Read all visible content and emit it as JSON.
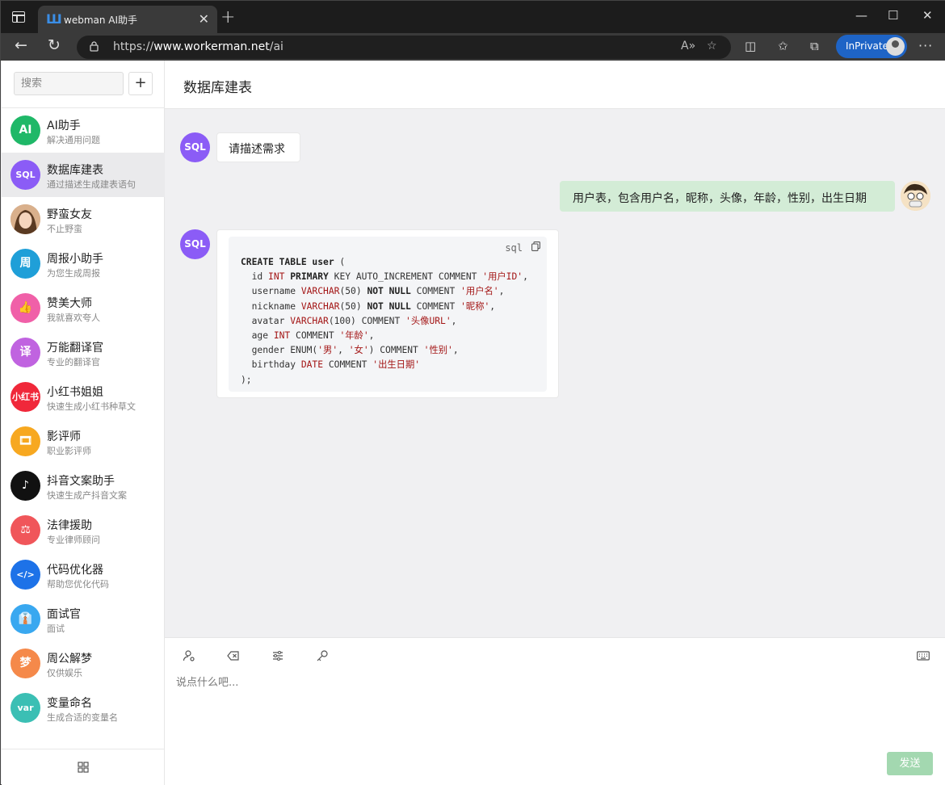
{
  "browser": {
    "tab_title": "webman AI助手",
    "url_scheme": "https://",
    "url_host": "www.workerman.net",
    "url_path": "/ai",
    "inprivate_label": "InPrivate"
  },
  "sidebar": {
    "search_placeholder": "搜索",
    "add_label": "+",
    "bots": [
      {
        "name": "AI助手",
        "desc": "解决通用问题",
        "avatar_text": "AI",
        "color": "#1fb868"
      },
      {
        "name": "数据库建表",
        "desc": "通过描述生成建表语句",
        "avatar_text": "SQL",
        "color": "#8b5cf6"
      },
      {
        "name": "野蛮女友",
        "desc": "不止野蛮",
        "avatar_text": "",
        "color": "#c9a07c"
      },
      {
        "name": "周报小助手",
        "desc": "为您生成周报",
        "avatar_text": "周",
        "color": "#1f9fd8"
      },
      {
        "name": "赞美大师",
        "desc": "我就喜欢夸人",
        "avatar_text": "👍",
        "color": "#f060a8"
      },
      {
        "name": "万能翻译官",
        "desc": "专业的翻译官",
        "avatar_text": "译",
        "color": "#c063e0"
      },
      {
        "name": "小红书姐姐",
        "desc": "快速生成小红书种草文",
        "avatar_text": "小红书",
        "color": "#f0283a"
      },
      {
        "name": "影评师",
        "desc": "职业影评师",
        "avatar_text": "🎞",
        "color": "#f7a820"
      },
      {
        "name": "抖音文案助手",
        "desc": "快速生成产抖音文案",
        "avatar_text": "♪",
        "color": "#111111"
      },
      {
        "name": "法律援助",
        "desc": "专业律师顾问",
        "avatar_text": "⚖",
        "color": "#f0565a"
      },
      {
        "name": "代码优化器",
        "desc": "帮助您优化代码",
        "avatar_text": "</>",
        "color": "#1d72e8"
      },
      {
        "name": "面试官",
        "desc": "面试",
        "avatar_text": "👔",
        "color": "#39a8f0"
      },
      {
        "name": "周公解梦",
        "desc": "仅供娱乐",
        "avatar_text": "梦",
        "color": "#f5894a"
      },
      {
        "name": "变量命名",
        "desc": "生成合适的变量名",
        "avatar_text": "var",
        "color": "#3bbfb4"
      }
    ]
  },
  "chat": {
    "title": "数据库建表",
    "bot_avatar_text": "SQL",
    "bot_greeting": "请描述需求",
    "user_message": "用户表，包含用户名，昵称，头像，年龄，性别，出生日期",
    "code_lang": "sql",
    "code_lines": [
      "CREATE TABLE user (",
      "  id INT PRIMARY KEY AUTO_INCREMENT COMMENT '用户ID',",
      "  username VARCHAR(50) NOT NULL COMMENT '用户名',",
      "  nickname VARCHAR(50) NOT NULL COMMENT '昵称',",
      "  avatar VARCHAR(100) COMMENT '头像URL',",
      "  age INT COMMENT '年龄',",
      "  gender ENUM('男', '女') COMMENT '性别',",
      "  birthday DATE COMMENT '出生日期'",
      ");"
    ]
  },
  "composer": {
    "placeholder": "说点什么吧...",
    "send_label": "发送"
  }
}
